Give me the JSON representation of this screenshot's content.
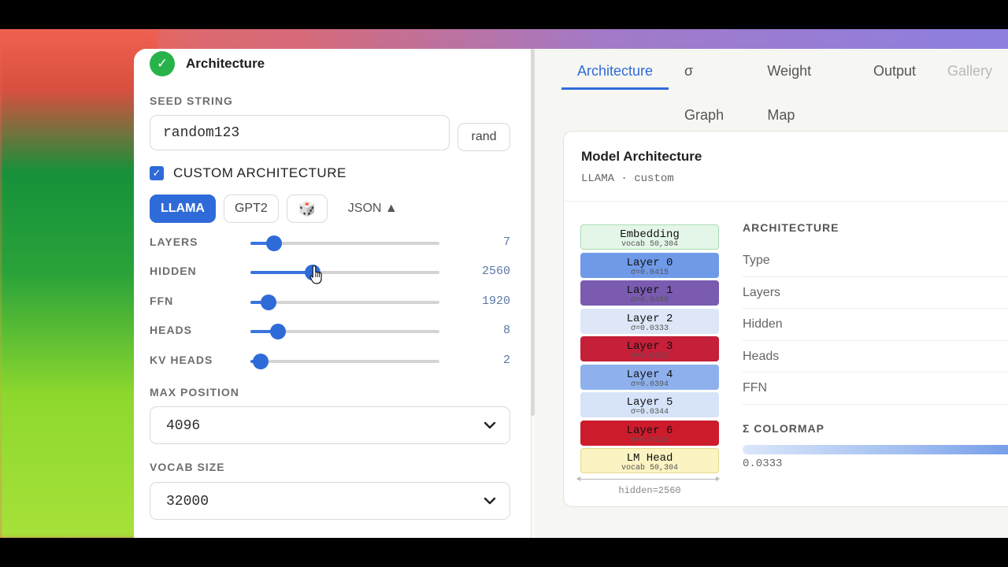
{
  "header": {
    "title": "Architecture"
  },
  "seed": {
    "label": "SEED STRING",
    "value": "random123",
    "rand_label": "rand"
  },
  "custom_arch": {
    "label": "CUSTOM ARCHITECTURE",
    "checked": true
  },
  "arch_buttons": [
    {
      "label": "LLAMA",
      "active": true
    },
    {
      "label": "GPT2",
      "active": false
    },
    {
      "label": "🎲",
      "active": false
    }
  ],
  "json_toggle": "JSON ▲",
  "sliders": [
    {
      "label": "LAYERS",
      "value": "7",
      "fraction": 0.125
    },
    {
      "label": "HIDDEN",
      "value": "2560",
      "fraction": 0.33
    },
    {
      "label": "FFN",
      "value": "1920",
      "fraction": 0.095
    },
    {
      "label": "HEADS",
      "value": "8",
      "fraction": 0.145
    },
    {
      "label": "KV HEADS",
      "value": "2",
      "fraction": 0.055
    }
  ],
  "max_position": {
    "label": "MAX POSITION",
    "value": "4096"
  },
  "vocab_size": {
    "label": "VOCAB SIZE",
    "value": "32000"
  },
  "tabs": [
    {
      "label": "Architecture",
      "state": "active"
    },
    {
      "label": "σ Graph",
      "state": "normal"
    },
    {
      "label": "Weight Map",
      "state": "normal"
    },
    {
      "label": "Output",
      "state": "normal"
    },
    {
      "label": "Gallery",
      "state": "dim"
    }
  ],
  "card": {
    "title": "Model Architecture",
    "subtitle": "LLAMA · custom",
    "blocks": [
      {
        "name": "Embedding",
        "sub": "vocab 50,304",
        "bg": "#e4f6e8",
        "border": "#a8dcb4"
      },
      {
        "name": "Layer 0",
        "sub": "σ=0.0415",
        "bg": "#6f9ae8",
        "border": "#6f9ae8"
      },
      {
        "name": "Layer 1",
        "sub": "σ=0.0489",
        "bg": "#7a5bb0",
        "border": "#7a5bb0"
      },
      {
        "name": "Layer 2",
        "sub": "σ=0.0333",
        "bg": "#dde7f8",
        "border": "#dde7f8"
      },
      {
        "name": "Layer 3",
        "sub": "σ=0.0512",
        "bg": "#c51f3a",
        "border": "#c51f3a"
      },
      {
        "name": "Layer 4",
        "sub": "σ=0.0394",
        "bg": "#8eb1ee",
        "border": "#8eb1ee"
      },
      {
        "name": "Layer 5",
        "sub": "σ=0.0344",
        "bg": "#d6e3f8",
        "border": "#d6e3f8"
      },
      {
        "name": "Layer 6",
        "sub": "σ=0.0518",
        "bg": "#cc1c2c",
        "border": "#cc1c2c"
      },
      {
        "name": "LM Head",
        "sub": "vocab 50,304",
        "bg": "#fbf3c2",
        "border": "#e8d98a"
      }
    ],
    "axis_label": "hidden=2560",
    "info_heading": "ARCHITECTURE",
    "info_rows": [
      "Type",
      "Layers",
      "Hidden",
      "Heads",
      "FFN"
    ],
    "colormap_heading": "Σ COLORMAP",
    "colormap_min": "0.0333"
  },
  "colors": {
    "accent": "#2f6bd8",
    "success": "#27b24a"
  }
}
